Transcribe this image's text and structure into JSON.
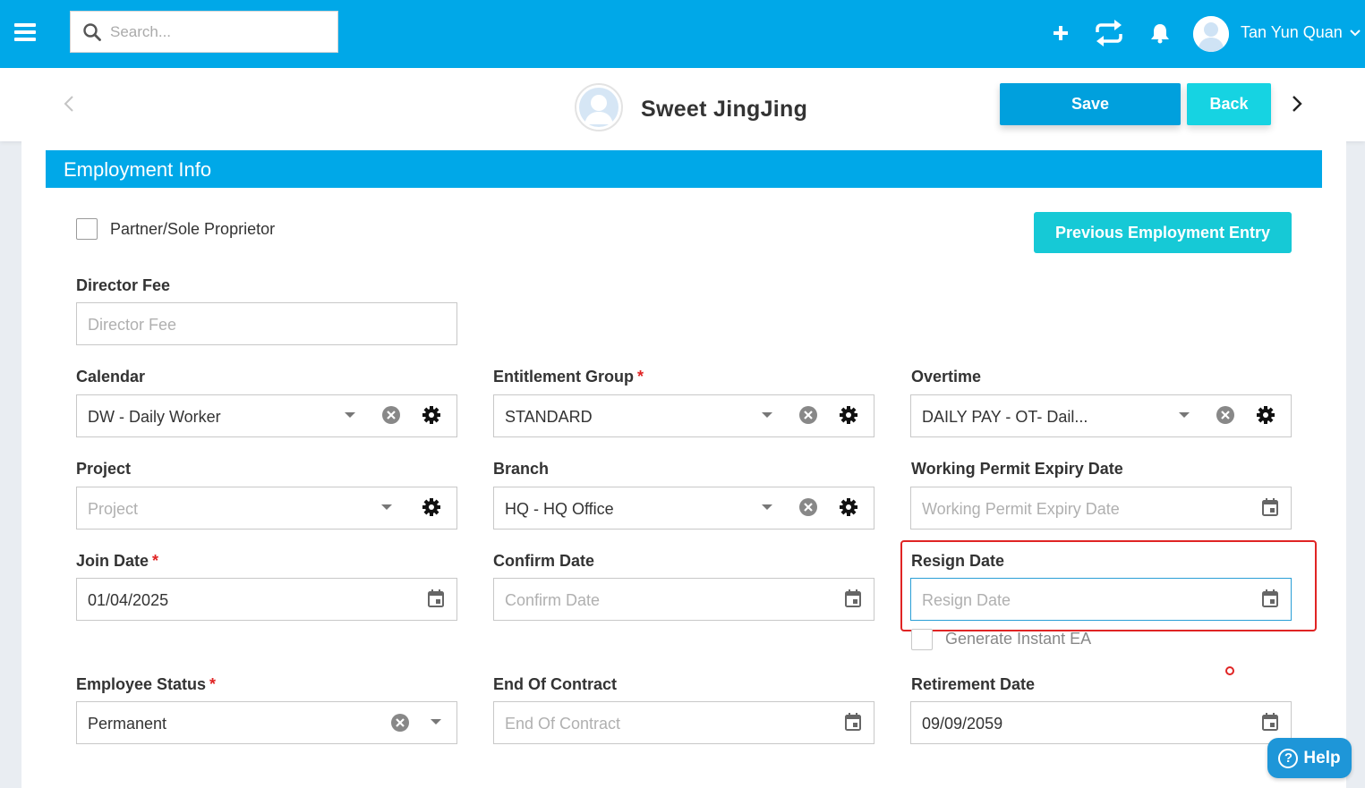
{
  "topbar": {
    "search_placeholder": "Search...",
    "user_name": "Tan Yun Quan",
    "icons": [
      "menu-icon",
      "search-icon",
      "plus-icon",
      "sync-icon",
      "bell-icon",
      "user-avatar",
      "chevron-down-icon"
    ]
  },
  "header": {
    "employee_name": "Sweet JingJing",
    "save_label": "Save",
    "back_label": "Back"
  },
  "section": {
    "title": "Employment Info",
    "partner_label": "Partner/Sole Proprietor",
    "partner_checked": false,
    "previous_employment_label": "Previous Employment Entry"
  },
  "fields": {
    "director_fee": {
      "label": "Director Fee",
      "placeholder": "Director Fee",
      "value": ""
    },
    "calendar": {
      "label": "Calendar",
      "value": "DW - Daily Worker"
    },
    "entitlement_group": {
      "label": "Entitlement Group",
      "required": "*",
      "value": "STANDARD"
    },
    "overtime": {
      "label": "Overtime",
      "value": "DAILY PAY - OT- Dail..."
    },
    "project": {
      "label": "Project",
      "placeholder": "Project",
      "value": ""
    },
    "branch": {
      "label": "Branch",
      "value": "HQ - HQ Office"
    },
    "working_permit_expiry": {
      "label": "Working Permit Expiry Date",
      "placeholder": "Working Permit Expiry Date",
      "value": ""
    },
    "join_date": {
      "label": "Join Date",
      "required": "*",
      "value": "01/04/2025"
    },
    "confirm_date": {
      "label": "Confirm Date",
      "placeholder": "Confirm Date",
      "value": ""
    },
    "resign_date": {
      "label": "Resign Date",
      "placeholder": "Resign Date",
      "value": ""
    },
    "generate_ea": {
      "label": "Generate Instant EA",
      "checked": false
    },
    "employee_status": {
      "label": "Employee Status",
      "required": "*",
      "value": "Permanent"
    },
    "end_of_contract": {
      "label": "End Of Contract",
      "placeholder": "End Of Contract",
      "value": ""
    },
    "retirement_date": {
      "label": "Retirement Date",
      "value": "09/09/2059"
    }
  },
  "help": {
    "label": "Help"
  },
  "colors": {
    "primary": "#00a8e8",
    "accent": "#16d3e2",
    "required": "#e02424"
  }
}
